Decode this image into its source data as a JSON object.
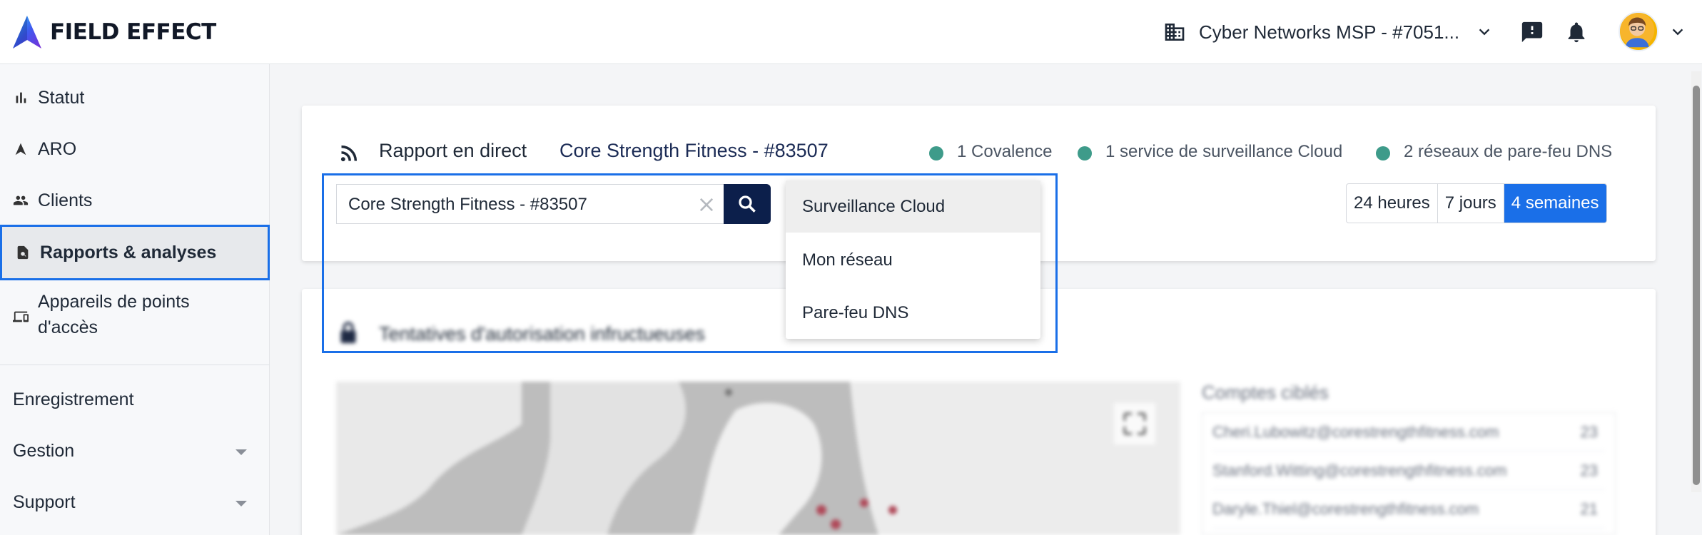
{
  "header": {
    "brand": "FIELD EFFECT",
    "org_name": "Cyber Networks MSP - #7051...",
    "icons": [
      "building-icon",
      "chevron-down-icon",
      "feedback-icon",
      "bell-icon",
      "avatar",
      "chevron-down-icon"
    ]
  },
  "sidebar": {
    "items": [
      {
        "label": "Statut",
        "icon": "bar-chart-icon"
      },
      {
        "label": "ARO",
        "icon": "arrow-up-icon"
      },
      {
        "label": "Clients",
        "icon": "people-icon"
      },
      {
        "label": "Rapports & analyses",
        "icon": "report-icon",
        "active": true
      },
      {
        "label_line1": "Appareils de points",
        "label_line2": "d'accès",
        "icon": "devices-icon"
      }
    ],
    "sections": [
      {
        "label": "Enregistrement"
      },
      {
        "label": "Gestion",
        "expandable": true
      },
      {
        "label": "Support",
        "expandable": true
      }
    ]
  },
  "report": {
    "title": "Rapport en direct",
    "client": "Core Strength Fitness - #83507",
    "stats": [
      "1 Covalence",
      "1 service de surveillance Cloud",
      "2 réseaux de pare-feu DNS"
    ],
    "status_color": "#3e9b8a",
    "search_value": "Core Strength Fitness - #83507",
    "ranges": [
      {
        "label": "24 heures",
        "active": false
      },
      {
        "label": "7 jours",
        "active": false
      },
      {
        "label": "4 semaines",
        "active": true
      }
    ]
  },
  "dropdown": {
    "options": [
      "Surveillance Cloud",
      "Mon réseau",
      "Pare-feu DNS"
    ],
    "selected": "Surveillance Cloud"
  },
  "auth_card": {
    "title": "Tentatives d'autorisation infructueuses",
    "accounts_title": "Comptes ciblés",
    "accounts": [
      {
        "email": "Cheri.Lubowitz@corestrengthfitness.com",
        "count": "23"
      },
      {
        "email": "Stanford.Witting@corestrengthfitness.com",
        "count": "23"
      },
      {
        "email": "Daryle.Thiel@corestrengthfitness.com",
        "count": "21"
      }
    ]
  },
  "colors": {
    "accent": "#1a6fe8",
    "search_button": "#0c1f4b"
  }
}
